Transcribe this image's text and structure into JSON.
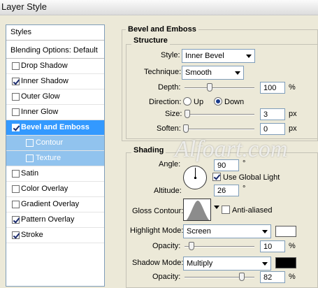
{
  "window": {
    "title": "Layer Style"
  },
  "sidebar": {
    "header": "Styles",
    "blending": "Blending Options: Default",
    "items": [
      {
        "label": "Drop Shadow",
        "checked": false
      },
      {
        "label": "Inner Shadow",
        "checked": true
      },
      {
        "label": "Outer Glow",
        "checked": false
      },
      {
        "label": "Inner Glow",
        "checked": false
      },
      {
        "label": "Bevel and Emboss",
        "checked": true,
        "selected": true
      },
      {
        "label": "Contour",
        "checked": false,
        "sub": true
      },
      {
        "label": "Texture",
        "checked": false,
        "sub": true
      },
      {
        "label": "Satin",
        "checked": false
      },
      {
        "label": "Color Overlay",
        "checked": false
      },
      {
        "label": "Gradient Overlay",
        "checked": false
      },
      {
        "label": "Pattern Overlay",
        "checked": true
      },
      {
        "label": "Stroke",
        "checked": true
      }
    ]
  },
  "bevel": {
    "title": "Bevel and Emboss",
    "structure": {
      "title": "Structure",
      "style_label": "Style:",
      "style_value": "Inner Bevel",
      "technique_label": "Technique:",
      "technique_value": "Smooth",
      "depth_label": "Depth:",
      "depth_value": "100",
      "depth_unit": "%",
      "direction_label": "Direction:",
      "dir_up": "Up",
      "dir_down": "Down",
      "direction_selected": "Down",
      "size_label": "Size:",
      "size_value": "3",
      "size_unit": "px",
      "soften_label": "Soften:",
      "soften_value": "0",
      "soften_unit": "px"
    },
    "shading": {
      "title": "Shading",
      "angle_label": "Angle:",
      "angle_value": "90",
      "angle_unit": "°",
      "global_light_label": "Use Global Light",
      "global_light": true,
      "altitude_label": "Altitude:",
      "altitude_value": "26",
      "altitude_unit": "°",
      "gloss_label": "Gloss Contour:",
      "antialiased_label": "Anti-aliased",
      "antialiased": false,
      "highlight_mode_label": "Highlight Mode:",
      "highlight_mode_value": "Screen",
      "highlight_color": "#ffffff",
      "highlight_opacity_label": "Opacity:",
      "highlight_opacity_value": "10",
      "highlight_opacity_unit": "%",
      "shadow_mode_label": "Shadow Mode:",
      "shadow_mode_value": "Multiply",
      "shadow_color": "#000000",
      "shadow_opacity_label": "Opacity:",
      "shadow_opacity_value": "82",
      "shadow_opacity_unit": "%"
    }
  },
  "watermark": "Alfoart.com"
}
